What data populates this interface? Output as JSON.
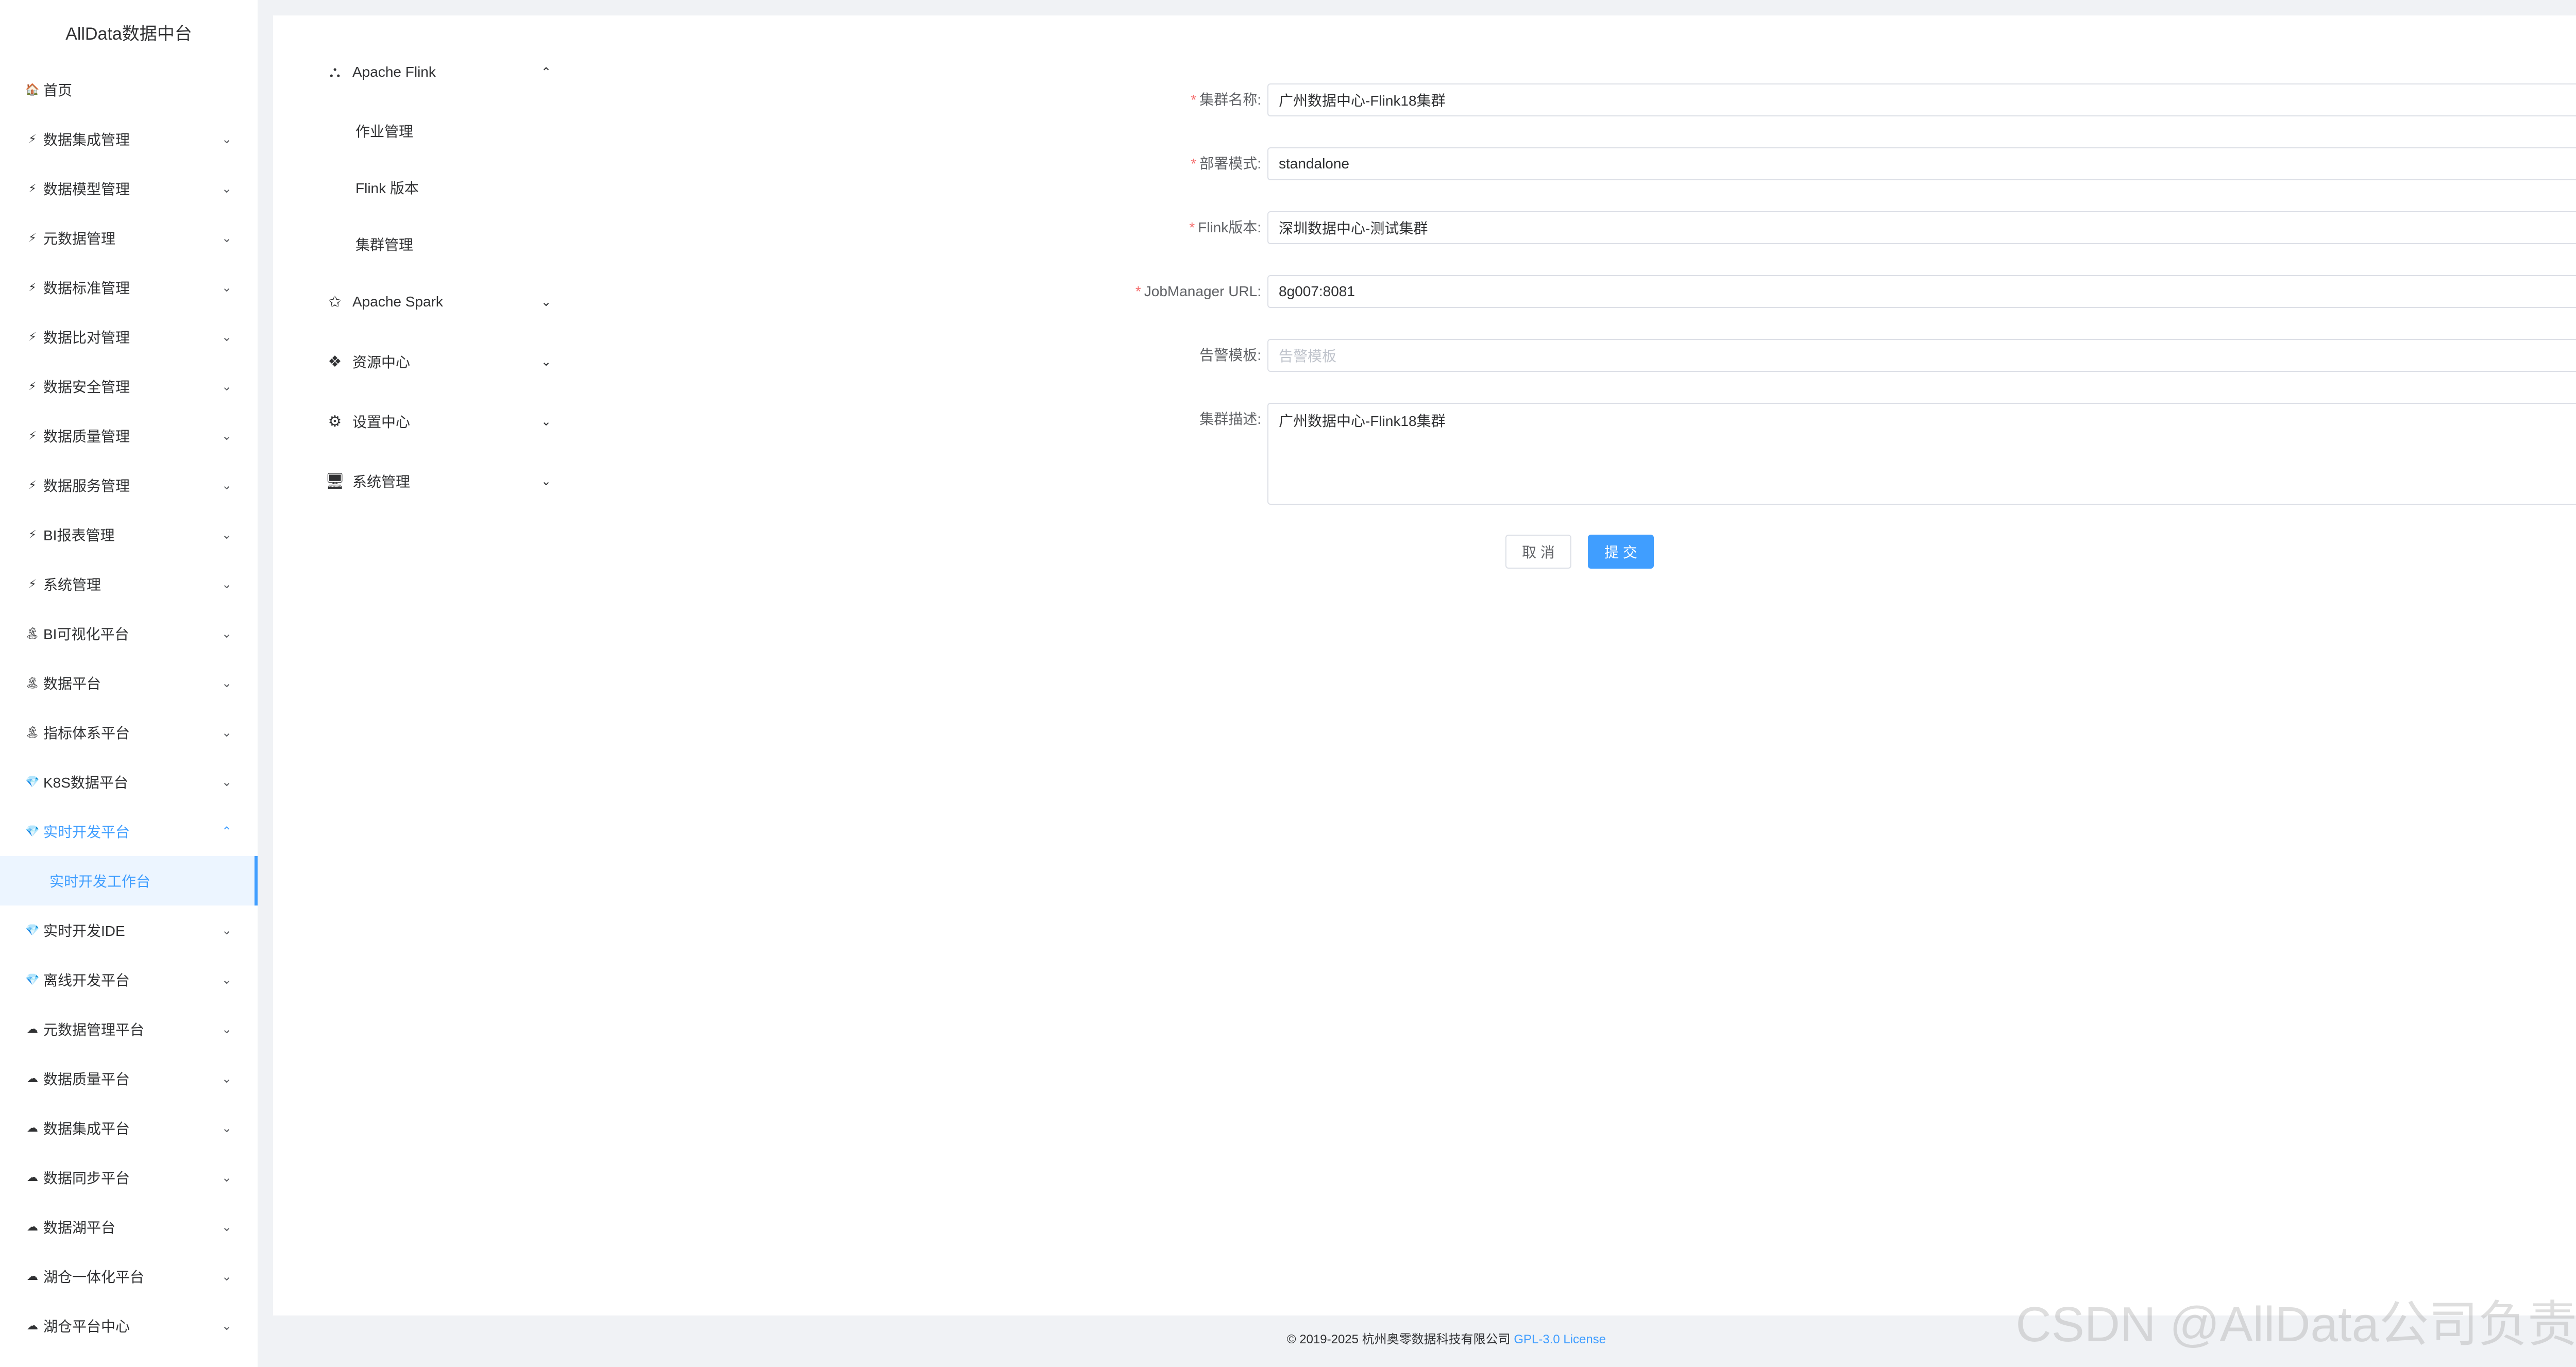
{
  "app": {
    "brand": "AllData数据中台"
  },
  "sidebar": {
    "items": [
      {
        "label": "首页",
        "icon": "🏠",
        "chevron": ""
      },
      {
        "label": "数据集成管理",
        "icon": "⚡",
        "chevron": "⌄"
      },
      {
        "label": "数据模型管理",
        "icon": "⚡",
        "chevron": "⌄"
      },
      {
        "label": "元数据管理",
        "icon": "⚡",
        "chevron": "⌄"
      },
      {
        "label": "数据标准管理",
        "icon": "⚡",
        "chevron": "⌄"
      },
      {
        "label": "数据比对管理",
        "icon": "⚡",
        "chevron": "⌄"
      },
      {
        "label": "数据安全管理",
        "icon": "⚡",
        "chevron": "⌄"
      },
      {
        "label": "数据质量管理",
        "icon": "⚡",
        "chevron": "⌄"
      },
      {
        "label": "数据服务管理",
        "icon": "⚡",
        "chevron": "⌄"
      },
      {
        "label": "BI报表管理",
        "icon": "⚡",
        "chevron": "⌄"
      },
      {
        "label": "系统管理",
        "icon": "⚡",
        "chevron": "⌄"
      },
      {
        "label": "BI可视化平台",
        "icon": "🏝",
        "chevron": "⌄"
      },
      {
        "label": "数据平台",
        "icon": "🏝",
        "chevron": "⌄"
      },
      {
        "label": "指标体系平台",
        "icon": "🏝",
        "chevron": "⌄"
      },
      {
        "label": "K8S数据平台",
        "icon": "💎",
        "chevron": "⌄"
      },
      {
        "label": "实时开发平台",
        "icon": "💎",
        "chevron": "⌃"
      },
      {
        "label": "实时开发工作台",
        "icon": "",
        "chevron": ""
      },
      {
        "label": "实时开发IDE",
        "icon": "💎",
        "chevron": "⌄"
      },
      {
        "label": "离线开发平台",
        "icon": "💎",
        "chevron": "⌄"
      },
      {
        "label": "元数据管理平台",
        "icon": "☁",
        "chevron": "⌄"
      },
      {
        "label": "数据质量平台",
        "icon": "☁",
        "chevron": "⌄"
      },
      {
        "label": "数据集成平台",
        "icon": "☁",
        "chevron": "⌄"
      },
      {
        "label": "数据同步平台",
        "icon": "☁",
        "chevron": "⌄"
      },
      {
        "label": "数据湖平台",
        "icon": "☁",
        "chevron": "⌄"
      },
      {
        "label": "湖仓一体化平台",
        "icon": "☁",
        "chevron": "⌄"
      },
      {
        "label": "湖仓平台中心",
        "icon": "☁",
        "chevron": "⌄"
      }
    ]
  },
  "subnav": {
    "groups": [
      {
        "label": "Apache Flink",
        "icon": "⛬",
        "chevron": "⌃"
      },
      {
        "label": "Apache Spark",
        "icon": "✩",
        "chevron": "⌄"
      },
      {
        "label": "资源中心",
        "icon": "❖",
        "chevron": "⌄"
      },
      {
        "label": "设置中心",
        "icon": "⚙",
        "chevron": "⌄"
      },
      {
        "label": "系统管理",
        "icon": "🖥",
        "chevron": "⌄"
      }
    ],
    "flink_children": [
      {
        "label": "作业管理"
      },
      {
        "label": "Flink 版本"
      },
      {
        "label": "集群管理"
      }
    ]
  },
  "form": {
    "cluster_name": {
      "label": "集群名称:",
      "required": "*",
      "value": "广州数据中心-Flink18集群"
    },
    "deploy_mode": {
      "label": "部署模式:",
      "required": "*",
      "value": "standalone"
    },
    "flink_version": {
      "label": "Flink版本:",
      "required": "*",
      "value": "深圳数据中心-测试集群"
    },
    "jobmanager_url": {
      "label": "JobManager URL:",
      "required": "*",
      "value": "8g007:8081"
    },
    "alert_template": {
      "label": "告警模板:",
      "required": "",
      "placeholder": "告警模板"
    },
    "cluster_desc": {
      "label": "集群描述:",
      "required": "",
      "value": "广州数据中心-Flink18集群"
    },
    "cancel_label": "取 消",
    "submit_label": "提 交"
  },
  "footer": {
    "copyright": "© 2019-2025 杭州奥零数据科技有限公司 ",
    "license": "GPL-3.0 License"
  },
  "watermark": "CSDN @AllData公司负责人",
  "colors": {
    "primary": "#409eff",
    "required": "#f56c6c",
    "background": "#f0f2f5"
  }
}
